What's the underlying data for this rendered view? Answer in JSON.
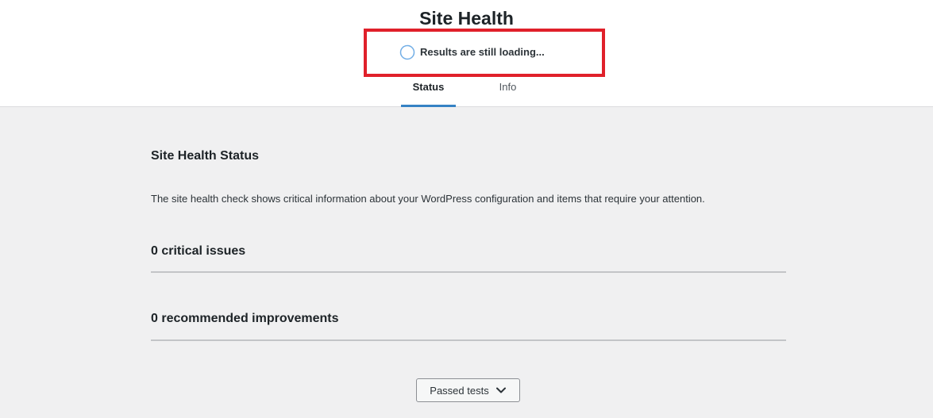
{
  "header": {
    "title": "Site Health",
    "loading_text": "Results are still loading...",
    "tabs": [
      {
        "label": "Status",
        "active": true
      },
      {
        "label": "Info",
        "active": false
      }
    ]
  },
  "status": {
    "title": "Site Health Status",
    "description": "The site health check shows critical information about your WordPress configuration and items that require your attention.",
    "critical_issues": "0 critical issues",
    "recommended_improvements": "0 recommended improvements",
    "passed_tests_label": "Passed tests"
  },
  "colors": {
    "accent": "#3582c4",
    "highlight": "#e0202a",
    "background": "#f0f0f1"
  },
  "icons": {
    "loading": "progress-ring-icon",
    "expand": "chevron-down-icon"
  }
}
